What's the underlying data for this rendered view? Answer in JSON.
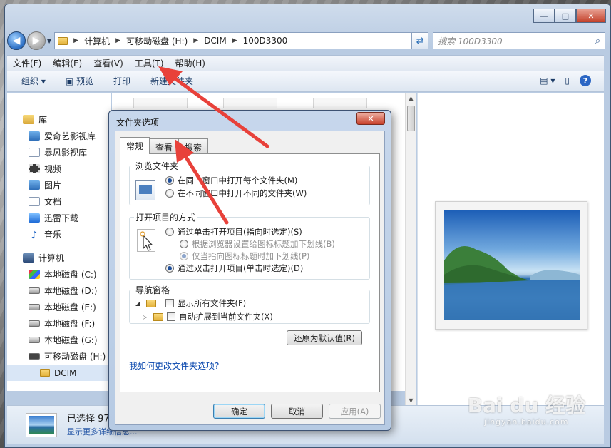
{
  "explorer": {
    "window_controls": {
      "minimize": "—",
      "maximize": "□",
      "close": "✕"
    },
    "breadcrumb": [
      "计算机",
      "可移动磁盘 (H:)",
      "DCIM",
      "100D3300"
    ],
    "search_placeholder": "搜索 100D3300",
    "menu": [
      "文件(F)",
      "编辑(E)",
      "查看(V)",
      "工具(T)",
      "帮助(H)"
    ],
    "toolbar": {
      "organize": "组织 ▾",
      "preview": "预览",
      "print": "打印",
      "new_folder": "新建文件夹"
    },
    "nav": {
      "library": "库",
      "library_items": [
        "爱奇艺影视库",
        "暴风影视库",
        "视频",
        "图片",
        "文档",
        "迅雷下载",
        "音乐"
      ],
      "computer": "计算机",
      "drives": [
        "本地磁盘 (C:)",
        "本地磁盘 (D:)",
        "本地磁盘 (E:)",
        "本地磁盘 (F:)",
        "本地磁盘 (G:)",
        "可移动磁盘 (H:)"
      ],
      "selected_folder": "DCIM"
    },
    "status": {
      "selected": "已选择 97",
      "more": "显示更多详细信息..."
    }
  },
  "dialog": {
    "title": "文件夹选项",
    "close": "✕",
    "tabs": [
      "常规",
      "查看",
      "搜索"
    ],
    "browse_group": {
      "title": "浏览文件夹",
      "options": [
        "在同一窗口中打开每个文件夹(M)",
        "在不同窗口中打开不同的文件夹(W)"
      ]
    },
    "click_group": {
      "title": "打开项目的方式",
      "single": "通过单击打开项目(指向时选定)(S)",
      "sub1": "根据浏览器设置给图标标题加下划线(B)",
      "sub2": "仅当指向图标标题时加下划线(P)",
      "double": "通过双击打开项目(单击时选定)(D)"
    },
    "nav_group": {
      "title": "导航窗格",
      "show_all": "显示所有文件夹(F)",
      "auto_expand": "自动扩展到当前文件夹(X)"
    },
    "restore_defaults": "还原为默认值(R)",
    "help_link": "我如何更改文件夹选项?",
    "buttons": {
      "ok": "确定",
      "cancel": "取消",
      "apply": "应用(A)"
    }
  },
  "watermark": {
    "brand": "Bai du 经验",
    "url": "jingyan.baidu.com"
  },
  "colors": {
    "arrow": "#e8413a",
    "link": "#0645ad",
    "radio_dot": "#1f4f9a"
  }
}
